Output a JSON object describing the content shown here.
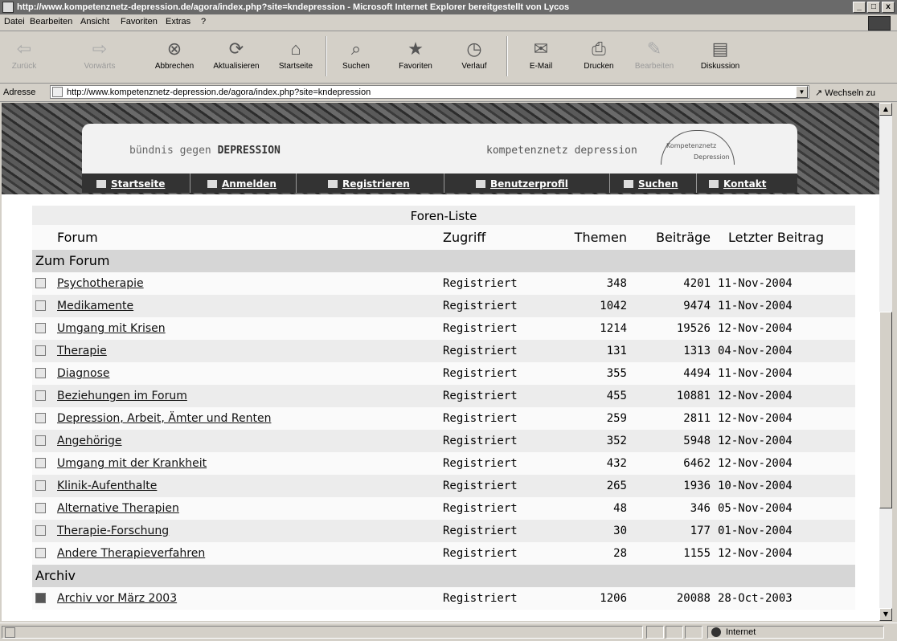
{
  "window": {
    "title": "http://www.kompetenznetz-depression.de/agora/index.php?site=kndepression - Microsoft Internet Explorer bereitgestellt von Lycos",
    "buttons": [
      "_",
      "□",
      "x"
    ]
  },
  "menubar": [
    "Datei",
    "Bearbeiten",
    "Ansicht",
    "Favoriten",
    "Extras",
    "?"
  ],
  "toolbar": [
    {
      "label": "Zurück",
      "glyph": "⇦",
      "disabled": true
    },
    {
      "label": "Vorwärts",
      "glyph": "⇨",
      "disabled": true
    },
    {
      "label": "Abbrechen",
      "glyph": "⊗",
      "disabled": false
    },
    {
      "label": "Aktualisieren",
      "glyph": "⟳",
      "disabled": false
    },
    {
      "label": "Startseite",
      "glyph": "⌂",
      "disabled": false
    },
    {
      "label": "Suchen",
      "glyph": "⌕",
      "disabled": false
    },
    {
      "label": "Favoriten",
      "glyph": "★",
      "disabled": false
    },
    {
      "label": "Verlauf",
      "glyph": "◷",
      "disabled": false
    },
    {
      "label": "E-Mail",
      "glyph": "✉",
      "disabled": false
    },
    {
      "label": "Drucken",
      "glyph": "⎙",
      "disabled": false
    },
    {
      "label": "Bearbeiten",
      "glyph": "✎",
      "disabled": true
    },
    {
      "label": "Diskussion",
      "glyph": "▤",
      "disabled": false
    }
  ],
  "address": {
    "label": "Adresse",
    "url": "http://www.kompetenznetz-depression.de/agora/index.php?site=kndepression",
    "go": "Wechseln zu"
  },
  "banner": {
    "left_logo_plain": "bündnis gegen ",
    "left_logo_bold": "DEPRESSION",
    "right_logo": "kompetenznetz depression",
    "badge_line1": "Kompetenznetz",
    "badge_line2": "Depression"
  },
  "nav": [
    "Startseite",
    "Anmelden",
    "Registrieren",
    "Benutzerprofil",
    "Suchen",
    "Kontakt"
  ],
  "forum": {
    "title": "Foren-Liste",
    "headers": {
      "forum": "Forum",
      "access": "Zugriff",
      "topics": "Themen",
      "posts": "Beiträge",
      "last": "Letzter Beitrag"
    },
    "category1": "Zum Forum",
    "rows": [
      {
        "name": "Psychotherapie",
        "access": "Registriert",
        "topics": "348",
        "posts": "4201",
        "last": "11-Nov-2004"
      },
      {
        "name": "Medikamente",
        "access": "Registriert",
        "topics": "1042",
        "posts": "9474",
        "last": "11-Nov-2004"
      },
      {
        "name": "Umgang mit Krisen",
        "access": "Registriert",
        "topics": "1214",
        "posts": "19526",
        "last": "12-Nov-2004"
      },
      {
        "name": "Therapie",
        "access": "Registriert",
        "topics": "131",
        "posts": "1313",
        "last": "04-Nov-2004"
      },
      {
        "name": "Diagnose",
        "access": "Registriert",
        "topics": "355",
        "posts": "4494",
        "last": "11-Nov-2004"
      },
      {
        "name": "Beziehungen im Forum",
        "access": "Registriert",
        "topics": "455",
        "posts": "10881",
        "last": "12-Nov-2004"
      },
      {
        "name": "Depression, Arbeit, Ämter und Renten",
        "access": "Registriert",
        "topics": "259",
        "posts": "2811",
        "last": "12-Nov-2004"
      },
      {
        "name": "Angehörige",
        "access": "Registriert",
        "topics": "352",
        "posts": "5948",
        "last": "12-Nov-2004"
      },
      {
        "name": "Umgang mit der Krankheit",
        "access": "Registriert",
        "topics": "432",
        "posts": "6462",
        "last": "12-Nov-2004"
      },
      {
        "name": "Klinik-Aufenthalte",
        "access": "Registriert",
        "topics": "265",
        "posts": "1936",
        "last": "10-Nov-2004"
      },
      {
        "name": "Alternative Therapien",
        "access": "Registriert",
        "topics": "48",
        "posts": "346",
        "last": "05-Nov-2004"
      },
      {
        "name": "Therapie-Forschung",
        "access": "Registriert",
        "topics": "30",
        "posts": "177",
        "last": "01-Nov-2004"
      },
      {
        "name": "Andere Therapieverfahren",
        "access": "Registriert",
        "topics": "28",
        "posts": "1155",
        "last": "12-Nov-2004"
      }
    ],
    "category2": "Archiv",
    "archive": {
      "name": "Archiv vor März 2003",
      "access": "Registriert",
      "topics": "1206",
      "posts": "20088",
      "last": "28-Oct-2003"
    }
  },
  "status": {
    "zone": "Internet"
  }
}
